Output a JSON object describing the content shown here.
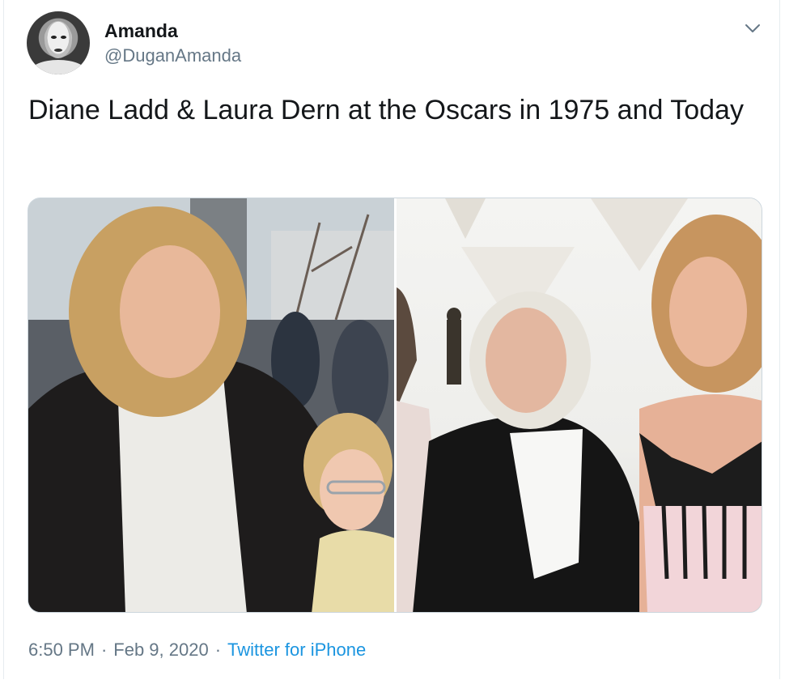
{
  "author": {
    "name": "Amanda",
    "handle": "@DuganAmanda"
  },
  "tweet": {
    "text": "Diane Ladd & Laura Dern at the Oscars in 1975 and Today"
  },
  "meta": {
    "time": "6:50 PM",
    "separator": "·",
    "date": "Feb 9, 2020",
    "source": "Twitter for iPhone"
  },
  "icons": {
    "menu": "chevron-down-icon"
  },
  "colors": {
    "text": "#14171a",
    "secondary": "#657786",
    "link": "#1b95e0",
    "border": "#ccd6dd"
  }
}
